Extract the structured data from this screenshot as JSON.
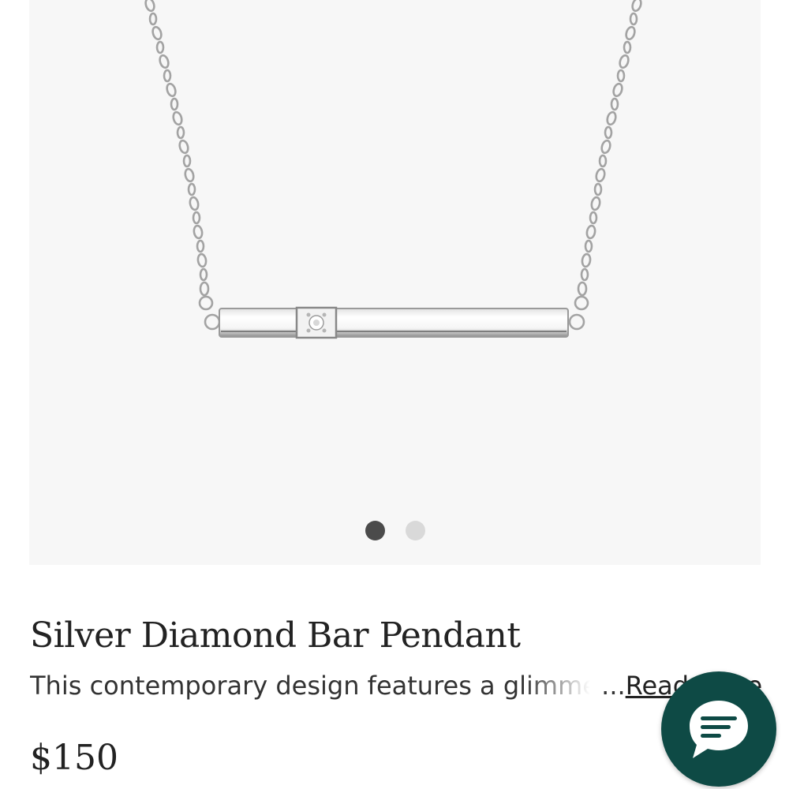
{
  "gallery": {
    "background_color": "#f7f7f7",
    "image_icon": "silver-bar-pendant-necklace",
    "slide_count": 2,
    "active_slide": 1
  },
  "product": {
    "title": "Silver Diamond Bar Pendant",
    "description": "This contemporary design features a glimmer",
    "ellipsis": "...",
    "read_more": "Read more",
    "price": "$150"
  },
  "chat": {
    "icon": "chat-bubble-icon",
    "color": "#0e4a45"
  }
}
